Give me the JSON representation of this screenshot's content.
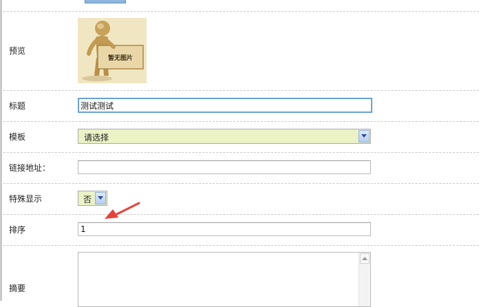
{
  "form": {
    "preview": {
      "label": "预览",
      "placeholder_image_text": "暂无图片"
    },
    "title": {
      "label": "标题",
      "value": "测试测试"
    },
    "template": {
      "label": "模板",
      "selected": "请选择"
    },
    "link": {
      "label": "链接地址：",
      "value": ""
    },
    "special_display": {
      "label": "特殊显示",
      "selected": "否"
    },
    "sort": {
      "label": "排序",
      "value": "1"
    },
    "summary": {
      "label": "摘要",
      "value": ""
    }
  },
  "colors": {
    "select_bg": "#eaf2c6",
    "focus_border": "#6aa1d6",
    "annotation_arrow": "#e8413b",
    "preview_bg": "#f1e6c2"
  },
  "icons": {
    "preview": "person-holding-sign-image",
    "dropdown": "chevron-down-icon",
    "annotation": "red-arrow"
  }
}
